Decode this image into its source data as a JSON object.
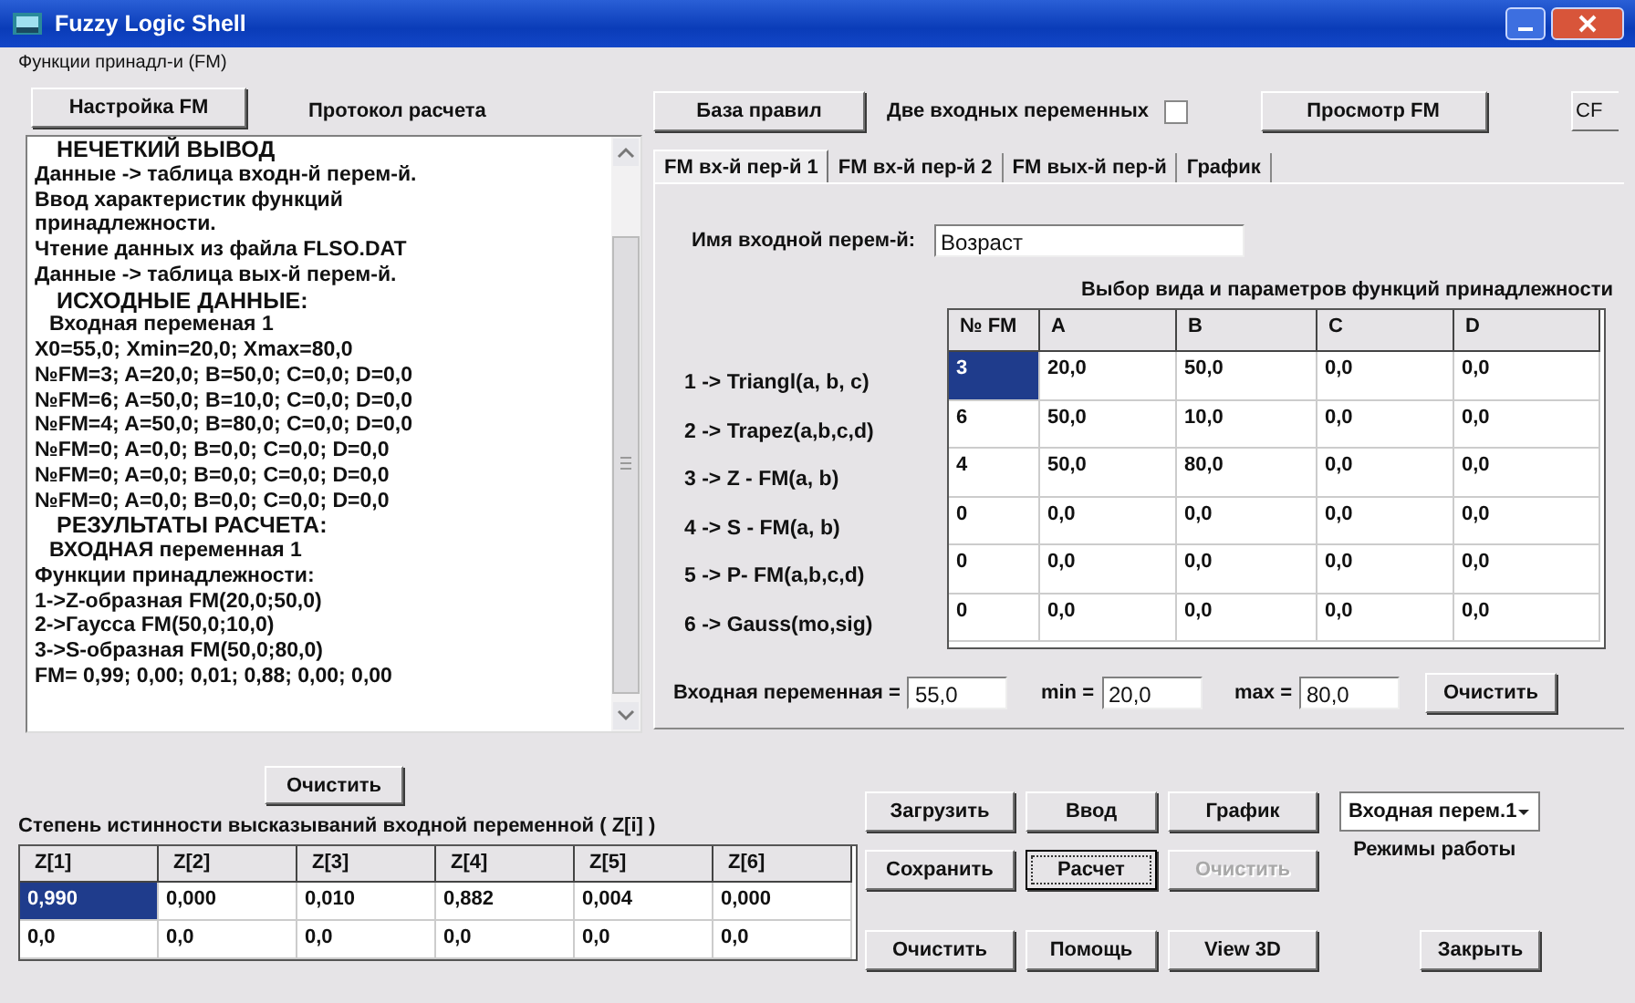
{
  "window": {
    "title": "Fuzzy Logic Shell"
  },
  "menu": [
    {
      "label": "Функции принадл-и (FM)"
    }
  ],
  "left_panel": {
    "setup_button": "Настройка FM",
    "log_title": "Протокол расчета",
    "log_lines": [
      {
        "kind": "heading",
        "text": "НЕЧЕТКИЙ ВЫВОД"
      },
      {
        "kind": "text",
        "text": "Данные -> таблица входн-й перем-й."
      },
      {
        "kind": "text",
        "text": "Ввод характеристик функций"
      },
      {
        "kind": "text",
        "text": "принадлежности."
      },
      {
        "kind": "text",
        "text": "Чтение данных из файла FLSO.DAT"
      },
      {
        "kind": "text",
        "text": "Данные -> таблица вых-й перем-й."
      },
      {
        "kind": "heading",
        "text": "ИСХОДНЫЕ ДАННЫЕ:"
      },
      {
        "kind": "subheading",
        "text": "Входная переменая 1"
      },
      {
        "kind": "text",
        "text": "X0=55,0; Xmin=20,0; Xmax=80,0"
      },
      {
        "kind": "text",
        "text": "№FM=3; A=20,0; B=50,0; C=0,0; D=0,0"
      },
      {
        "kind": "text",
        "text": "№FM=6; A=50,0; B=10,0; C=0,0; D=0,0"
      },
      {
        "kind": "text",
        "text": "№FM=4; A=50,0; B=80,0; C=0,0; D=0,0"
      },
      {
        "kind": "text",
        "text": "№FM=0; A=0,0; B=0,0; C=0,0; D=0,0"
      },
      {
        "kind": "text",
        "text": "№FM=0; A=0,0; B=0,0; C=0,0; D=0,0"
      },
      {
        "kind": "text",
        "text": "№FM=0; A=0,0; B=0,0; C=0,0; D=0,0"
      },
      {
        "kind": "heading",
        "text": "РЕЗУЛЬТАТЫ РАСЧЕТА:"
      },
      {
        "kind": "subheading",
        "text": "ВХОДНАЯ переменная 1"
      },
      {
        "kind": "text",
        "text": "Функции принадлежности:"
      },
      {
        "kind": "text",
        "text": "1->Z-образная FM(20,0;50,0)"
      },
      {
        "kind": "text",
        "text": "2->Гаусса FM(50,0;10,0)"
      },
      {
        "kind": "text",
        "text": "3->S-образная FM(50,0;80,0)"
      },
      {
        "kind": "text",
        "text": "FM= 0,99; 0,00; 0,01; 0,88; 0,00; 0,00"
      }
    ],
    "clear_button": "Очистить"
  },
  "right_panel": {
    "rules_button": "База правил",
    "two_inputs": {
      "label": "Две входных переменных",
      "checked": false
    },
    "view_button": "Просмотр FM",
    "cut_button": "CF",
    "tabs": [
      {
        "label": "FM вх-й пер-й 1",
        "selected": true
      },
      {
        "label": "FM вх-й пер-й 2",
        "selected": false
      },
      {
        "label": "FM вых-й пер-й",
        "selected": false
      },
      {
        "label": "График",
        "selected": false
      }
    ],
    "input_name": {
      "label": "Имя входной перем-й:",
      "value": "Возраст"
    },
    "table_title": "Выбор вида и параметров функций принадлежности",
    "fm_types": [
      "1 -> Triangl(a, b, c)",
      "2 -> Trapez(a,b,c,d)",
      "3 -> Z - FM(a, b)",
      "4 -> S - FM(a, b)",
      "5 -> P- FM(a,b,c,d)",
      "6 -> Gauss(mo,sig)"
    ],
    "fm_table": {
      "columns": [
        "№ FM",
        "A",
        "B",
        "C",
        "D"
      ],
      "rows": [
        {
          "cells": [
            {
              "text": "3",
              "selected": true
            },
            {
              "text": "20,0",
              "selected": false
            },
            {
              "text": "50,0",
              "selected": false
            },
            {
              "text": "0,0",
              "selected": false
            },
            {
              "text": "0,0",
              "selected": false
            }
          ]
        },
        {
          "cells": [
            {
              "text": "6",
              "selected": false
            },
            {
              "text": "50,0",
              "selected": false
            },
            {
              "text": "10,0",
              "selected": false
            },
            {
              "text": "0,0",
              "selected": false
            },
            {
              "text": "0,0",
              "selected": false
            }
          ]
        },
        {
          "cells": [
            {
              "text": "4",
              "selected": false
            },
            {
              "text": "50,0",
              "selected": false
            },
            {
              "text": "80,0",
              "selected": false
            },
            {
              "text": "0,0",
              "selected": false
            },
            {
              "text": "0,0",
              "selected": false
            }
          ]
        },
        {
          "cells": [
            {
              "text": "0",
              "selected": false
            },
            {
              "text": "0,0",
              "selected": false
            },
            {
              "text": "0,0",
              "selected": false
            },
            {
              "text": "0,0",
              "selected": false
            },
            {
              "text": "0,0",
              "selected": false
            }
          ]
        },
        {
          "cells": [
            {
              "text": "0",
              "selected": false
            },
            {
              "text": "0,0",
              "selected": false
            },
            {
              "text": "0,0",
              "selected": false
            },
            {
              "text": "0,0",
              "selected": false
            },
            {
              "text": "0,0",
              "selected": false
            }
          ]
        },
        {
          "cells": [
            {
              "text": "0",
              "selected": false
            },
            {
              "text": "0,0",
              "selected": false
            },
            {
              "text": "0,0",
              "selected": false
            },
            {
              "text": "0,0",
              "selected": false
            },
            {
              "text": "0,0",
              "selected": false
            }
          ]
        }
      ]
    },
    "range": [
      {
        "label": "Входная переменная =",
        "value": "55,0"
      },
      {
        "label": "min =",
        "value": "20,0"
      },
      {
        "label": "max =",
        "value": "80,0"
      }
    ],
    "range_clear_button": "Очистить"
  },
  "truth": {
    "title": "Степень истинности высказываний входной переменной ( Z[i] )",
    "columns": [
      "Z[1]",
      "Z[2]",
      "Z[3]",
      "Z[4]",
      "Z[5]",
      "Z[6]"
    ],
    "rows": [
      {
        "cells": [
          {
            "text": "0,990",
            "selected": true
          },
          {
            "text": "0,000",
            "selected": false
          },
          {
            "text": "0,010",
            "selected": false
          },
          {
            "text": "0,882",
            "selected": false
          },
          {
            "text": "0,004",
            "selected": false
          },
          {
            "text": "0,000",
            "selected": false
          }
        ]
      },
      {
        "cells": [
          {
            "text": "0,0",
            "selected": false
          },
          {
            "text": "0,0",
            "selected": false
          },
          {
            "text": "0,0",
            "selected": false
          },
          {
            "text": "0,0",
            "selected": false
          },
          {
            "text": "0,0",
            "selected": false
          },
          {
            "text": "0,0",
            "selected": false
          }
        ]
      }
    ]
  },
  "actions": {
    "buttons": [
      {
        "label": "Загрузить",
        "focused": false,
        "disabled": false
      },
      {
        "label": "Ввод",
        "focused": false,
        "disabled": false
      },
      {
        "label": "График",
        "focused": false,
        "disabled": false
      },
      {
        "label": "Сохранить",
        "focused": false,
        "disabled": false
      },
      {
        "label": "Расчет",
        "focused": true,
        "disabled": false
      },
      {
        "label": "Очистить",
        "focused": false,
        "disabled": true
      },
      {
        "label": "Очистить",
        "focused": false,
        "disabled": false
      },
      {
        "label": "Помощь",
        "focused": false,
        "disabled": false
      },
      {
        "label": "View 3D",
        "focused": false,
        "disabled": false
      }
    ],
    "mode_select": {
      "value": "Входная перем.1"
    },
    "mode_label": "Режимы работы",
    "close_button": "Закрыть"
  }
}
